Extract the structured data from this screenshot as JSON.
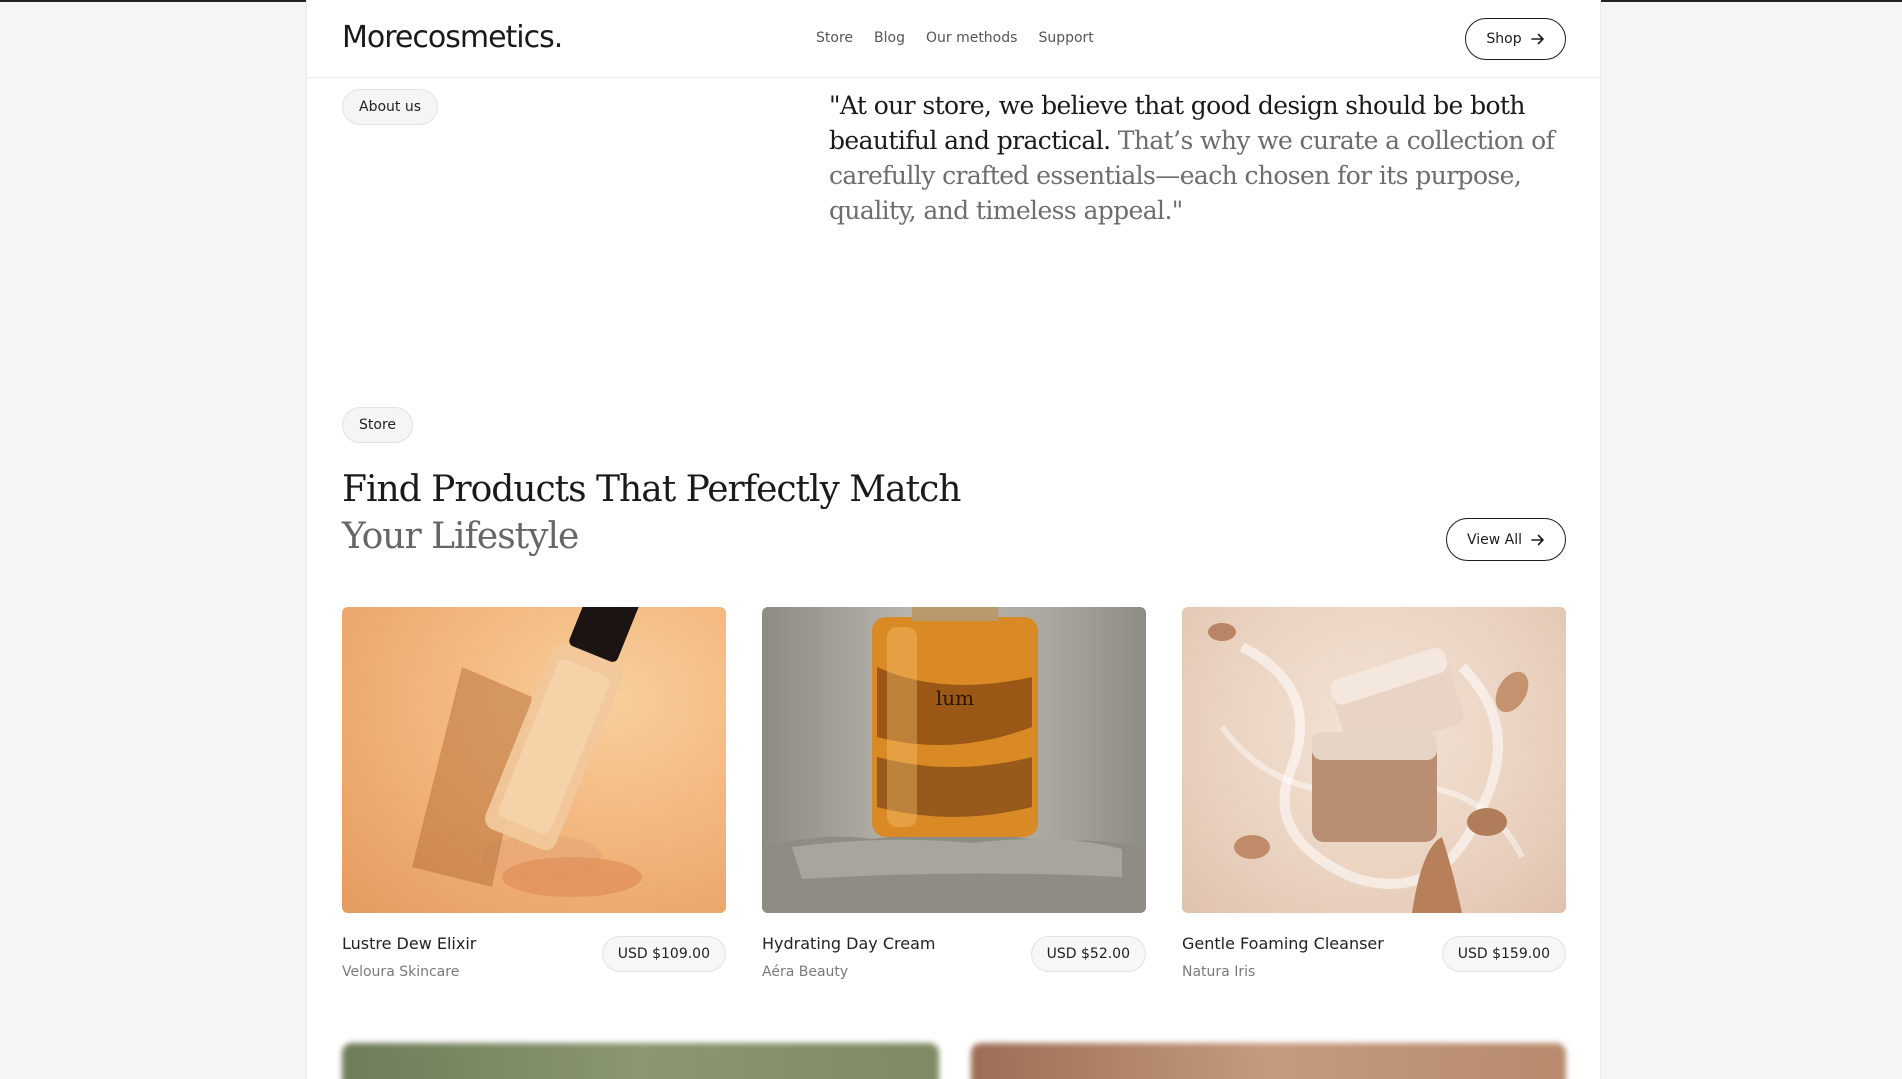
{
  "header": {
    "logo": "Morecosmetics.",
    "nav": [
      "Store",
      "Blog",
      "Our methods",
      "Support"
    ],
    "shop_label": "Shop"
  },
  "about": {
    "tag": "About us",
    "quote_dark": "\"At our store, we believe that good design should be both beautiful and practical.",
    "quote_light": " That’s why we curate a collection of carefully crafted essentials—each chosen for its purpose, quality, and timeless appeal.\""
  },
  "store": {
    "tag": "Store",
    "heading_line1": "Find Products That Perfectly Match",
    "heading_line2": "Your Lifestyle",
    "view_all_label": "View All",
    "products": [
      {
        "name": "Lustre Dew Elixir",
        "brand": "Veloura Skincare",
        "price": "USD $109.00"
      },
      {
        "name": "Hydrating Day Cream",
        "brand": "Aéra Beauty",
        "price": "USD $52.00",
        "bottle_text": "lum"
      },
      {
        "name": "Gentle Foaming Cleanser",
        "brand": "Natura Iris",
        "price": "USD $159.00"
      }
    ]
  },
  "icons": {
    "shop_arrow": "arrow-right-icon",
    "view_all_arrow": "arrow-right-icon"
  }
}
